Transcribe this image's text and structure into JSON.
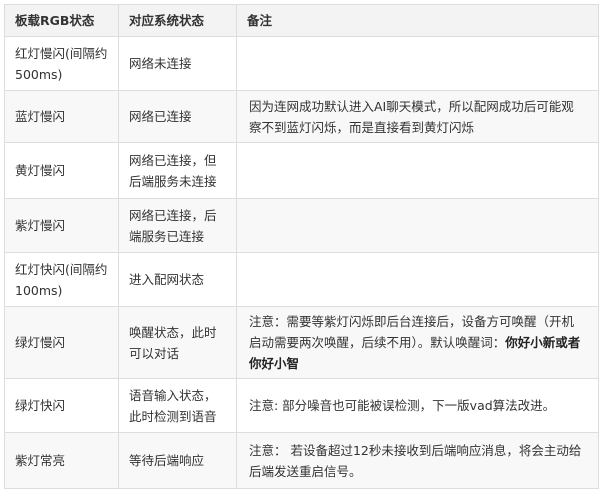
{
  "table": {
    "headers": [
      "板载RGB状态",
      "对应系统状态",
      "备注"
    ],
    "rows": [
      {
        "state": "红灯慢闪(间隔约500ms)",
        "system": "网络未连接",
        "note": "",
        "note_bold": ""
      },
      {
        "state": "蓝灯慢闪",
        "system": "网络已连接",
        "note": "因为连网成功默认进入AI聊天模式，所以配网成功后可能观察不到蓝灯闪烁，而是直接看到黄灯闪烁",
        "note_bold": ""
      },
      {
        "state": "黄灯慢闪",
        "system": "网络已连接，但后端服务未连接",
        "note": "",
        "note_bold": ""
      },
      {
        "state": "紫灯慢闪",
        "system": "网络已连接，后端服务已连接",
        "note": "",
        "note_bold": ""
      },
      {
        "state": "红灯快闪(间隔约100ms)",
        "system": "进入配网状态",
        "note": "",
        "note_bold": ""
      },
      {
        "state": "绿灯慢闪",
        "system": "唤醒状态，此时可以对话",
        "note": "注意：需要等紫灯闪烁即后台连接后，设备方可唤醒（开机启动需要两次唤醒，后续不用）。默认唤醒词：",
        "note_bold": "你好小新或者你好小智"
      },
      {
        "state": "绿灯快闪",
        "system": "语音输入状态，此时检测到语音",
        "note": "注意: 部分噪音也可能被误检测，下一版vad算法改进。",
        "note_bold": ""
      },
      {
        "state": "紫灯常亮",
        "system": "等待后端响应",
        "note": "注意： 若设备超过12秒未接收到后端响应消息，将会主动给后端发送重启信号。",
        "note_bold": ""
      }
    ]
  }
}
